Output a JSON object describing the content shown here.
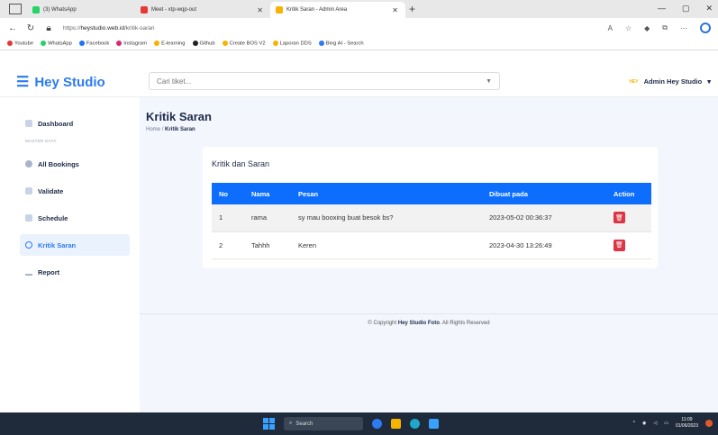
{
  "browser": {
    "tabs": [
      {
        "label": "(3) WhatsApp",
        "fav_color": "#25d366"
      },
      {
        "label": "Meet - xtp-wqp-out",
        "fav_color": "#e53935"
      },
      {
        "label": "Kritik Saran - Admin Area",
        "fav_color": "#f5b400"
      }
    ],
    "new_tab": "+",
    "url_prefix": "https://",
    "url_host": "heystudio.web.id",
    "url_path": "/kritik-saran",
    "bookmarks": [
      {
        "label": "Youtube",
        "color": "#e53935"
      },
      {
        "label": "WhatsApp",
        "color": "#25d366"
      },
      {
        "label": "Facebook",
        "color": "#1877f2"
      },
      {
        "label": "Instagram",
        "color": "#d62976"
      },
      {
        "label": "E-learning",
        "color": "#f5b400"
      },
      {
        "label": "Github",
        "color": "#222222"
      },
      {
        "label": "Create BOS V2",
        "color": "#f5b400"
      },
      {
        "label": "Laporan DDS",
        "color": "#f5b400"
      },
      {
        "label": "Bing AI - Search",
        "color": "#2c7bf2"
      }
    ]
  },
  "header": {
    "brand": "Hey Studio",
    "search_placeholder": "Cari tiket...",
    "admin_tag": "HEY",
    "admin_name": "Admin Hey Studio"
  },
  "sidebar": {
    "section_label": "MASTER DATA",
    "items": [
      {
        "label": "Dashboard",
        "icon": "grid-icon"
      },
      {
        "label": "All Bookings",
        "icon": "settings-icon"
      },
      {
        "label": "Validate",
        "icon": "file-icon"
      },
      {
        "label": "Schedule",
        "icon": "calendar-icon"
      },
      {
        "label": "Kritik Saran",
        "icon": "chat-icon"
      },
      {
        "label": "Report",
        "icon": "download-icon"
      }
    ]
  },
  "main": {
    "page_title": "Kritik Saran",
    "breadcrumb_home": "Home",
    "breadcrumb_sep": "/",
    "breadcrumb_current": "Kritik Saran",
    "card_title": "Kritik dan Saran",
    "table": {
      "headers": [
        "No",
        "Nama",
        "Pesan",
        "Dibuat pada",
        "Action"
      ],
      "rows": [
        {
          "no": "1",
          "nama": "rama",
          "pesan": "sy mau booxing buat besok bs?",
          "dibuat": "2023-05-02 00:36:37"
        },
        {
          "no": "2",
          "nama": "Tahhh",
          "pesan": "Keren",
          "dibuat": "2023-04-30 13:26:49"
        }
      ]
    },
    "copyright_prefix": "© Copyright",
    "copyright_brand": "Hey Studio Foto",
    "copyright_suffix": ". All Rights Reserved"
  },
  "taskbar": {
    "search_label": "Search",
    "time": "11:09",
    "date": "01/06/2023"
  },
  "colors": {
    "accent": "#2c7bf2",
    "table_header": "#0d6efd",
    "delete": "#dc3545"
  }
}
